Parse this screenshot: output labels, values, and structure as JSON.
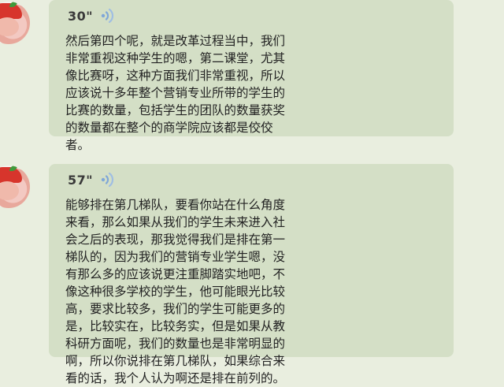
{
  "messages": [
    {
      "duration": "30\"",
      "voice_icon": "speaker-waves-icon",
      "transcript_lines": [
        "然后第四个呢，就是改革过程当中，我们",
        "非常重视这种学生的嗯，第二课堂，尤其",
        "像比赛呀，这种方面我们非常重视，所以",
        "应该说十多年整个营销专业所带的学生的",
        "比赛的数量，包括学生的团队的数量获奖",
        "的数量都在整个的商学院应该都是佼佼",
        "者。"
      ]
    },
    {
      "duration": "57\"",
      "voice_icon": "speaker-waves-icon",
      "transcript_lines": [
        "能够排在第几梯队，要看你站在什么角度",
        "来看，那么如果从我们的学生未来进入社",
        "会之后的表现，那我觉得我们是排在第一",
        "梯队的，因为我们的营销专业学生嗯，没",
        "有那么多的应该说更注重脚踏实地吧，不",
        "像这种很多学校的学生，他可能眼光比较",
        "高，要求比较多，我们的学生可能更多的",
        "是，比较实在，比较务实，但是如果从教",
        "科研方面呢，我们的数量也是非常明显的",
        "啊，所以你说排在第几梯队，如果综合来",
        "看的话，我个人认为啊还是排在前列的。"
      ]
    }
  ],
  "colors": {
    "background": "#e9eedf",
    "bubble": "#d4dfc6",
    "voice_icon": "#7fa7d8",
    "text": "#222222"
  }
}
